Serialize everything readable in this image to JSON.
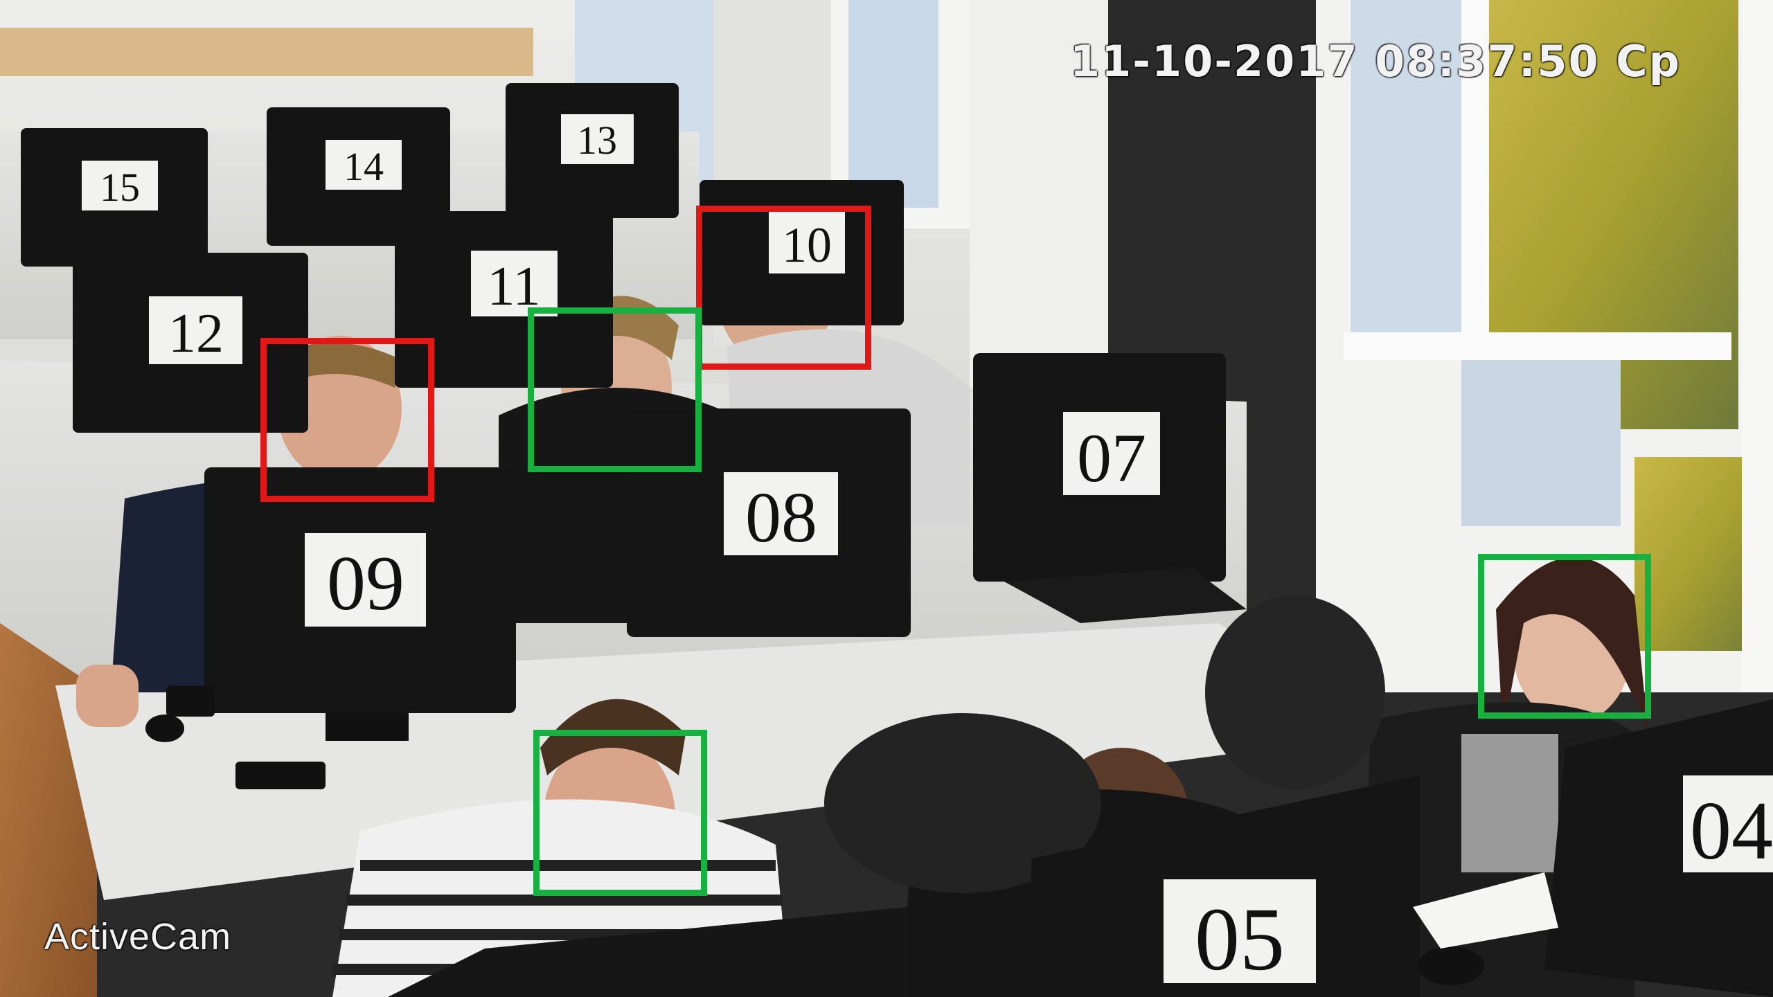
{
  "camera": {
    "timestamp": "11-10-2017 08:37:50 Cp",
    "watermark": "ActiveCam"
  },
  "workstations": [
    {
      "label": "15"
    },
    {
      "label": "14"
    },
    {
      "label": "13"
    },
    {
      "label": "12"
    },
    {
      "label": "11"
    },
    {
      "label": "10"
    },
    {
      "label": "09"
    },
    {
      "label": "08"
    },
    {
      "label": "07"
    },
    {
      "label": "05"
    },
    {
      "label": "04"
    }
  ],
  "detections": [
    {
      "status": "alert",
      "color": "#e01818"
    },
    {
      "status": "alert",
      "color": "#e01818"
    },
    {
      "status": "ok",
      "color": "#18b040"
    },
    {
      "status": "ok",
      "color": "#18b040"
    },
    {
      "status": "ok",
      "color": "#18b040"
    }
  ],
  "colors": {
    "alert": "#e01818",
    "ok": "#18b040"
  }
}
